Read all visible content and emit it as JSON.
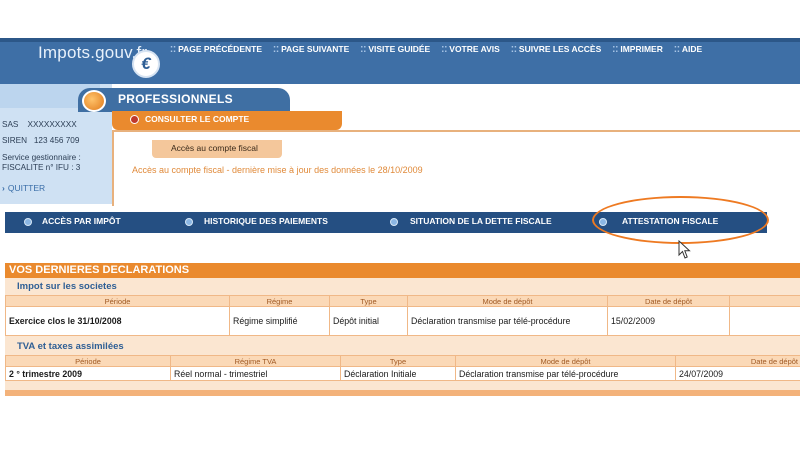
{
  "header": {
    "logo_text": "Impots.gouv.fr",
    "logo_mark": "€",
    "nav": [
      {
        "label": "PAGE PRÉCÉDENTE"
      },
      {
        "label": "PAGE SUIVANTE"
      },
      {
        "label": "VISITE GUIDÉE"
      },
      {
        "label": "VOTRE AVIS"
      },
      {
        "label": "SUIVRE LES ACCÈS"
      },
      {
        "label": "IMPRIMER"
      },
      {
        "label": "AIDE"
      }
    ]
  },
  "account": {
    "company_type": "SAS",
    "company_name": "XXXXXXXXX",
    "siren_label": "SIREN",
    "siren_value": "123 456 709",
    "service_label": "Service gestionnaire :",
    "service_value": "FISCALITE n° IFU : 3",
    "quit_label": "QUITTER"
  },
  "section": {
    "title": "PROFESSIONNELS",
    "subtab": "CONSULTER LE COMPTE",
    "fiscal_tab": "Accès au compte fiscal",
    "update_text": "Accès au compte fiscal - dernière mise à jour des données le 28/10/2009"
  },
  "navbar": {
    "items": [
      {
        "label": "ACCÈS PAR IMPÔT"
      },
      {
        "label": "HISTORIQUE DES PAIEMENTS"
      },
      {
        "label": "SITUATION DE LA DETTE FISCALE"
      },
      {
        "label": "ATTESTATION FISCALE"
      }
    ]
  },
  "declarations": {
    "title": "VOS DERNIERES DECLARATIONS",
    "is": {
      "subtitle": "Impot sur les societes",
      "headers": [
        "Période",
        "Régime",
        "Type",
        "Mode de dépôt",
        "Date de dépôt"
      ],
      "row": [
        "Exercice clos le 31/10/2008",
        "Régime simplifié",
        "Dépôt initial",
        "Déclaration transmise par télé-procédure",
        "15/02/2009"
      ]
    },
    "tva": {
      "subtitle": "TVA et taxes assimilées",
      "headers": [
        "Période",
        "Régime TVA",
        "Type",
        "Mode de dépôt",
        "Date de dépôt"
      ],
      "row": [
        "2 ° trimestre 2009",
        "Réel normal - trimestriel",
        "Déclaration Initiale",
        "Déclaration transmise par télé-procédure",
        "24/07/2009"
      ]
    }
  },
  "colors": {
    "header_blue": "#3e6fa6",
    "nav_blue": "#254f82",
    "accent_orange": "#ea8a2e",
    "panel_blue": "#cfe1f3"
  }
}
